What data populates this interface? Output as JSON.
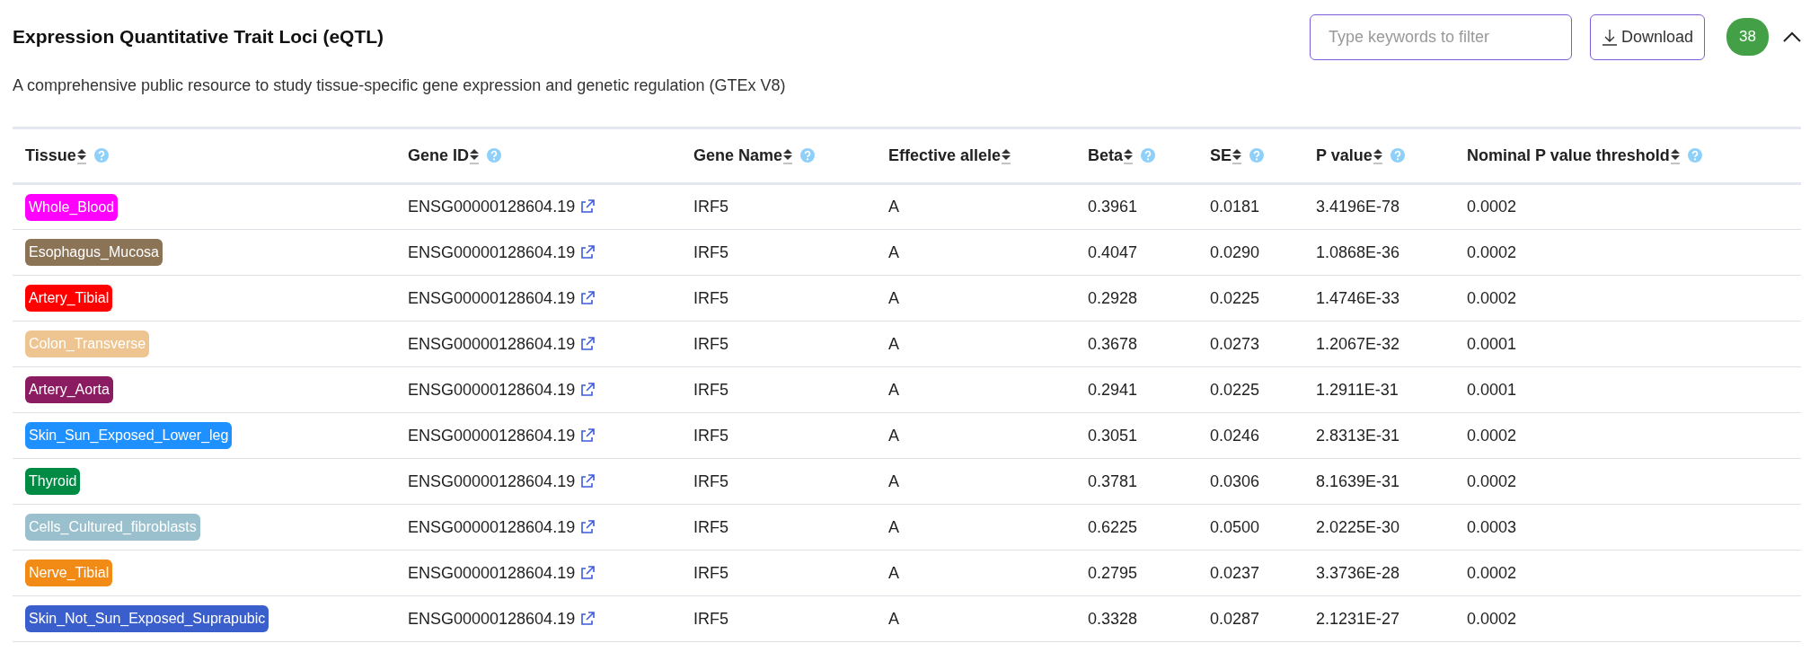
{
  "title": "Expression Quantitative Trait Loci (eQTL)",
  "filter": {
    "placeholder": "Type keywords to filter"
  },
  "download_button": "Download",
  "count_badge": "38",
  "collapse": {
    "expanded": true
  },
  "description": "A comprehensive public resource to study tissue-specific gene expression and genetic regulation (GTEx V8)",
  "table": {
    "columns": [
      {
        "label": "Tissue",
        "help": true
      },
      {
        "label": "Gene ID",
        "help": true
      },
      {
        "label": "Gene Name",
        "help": true
      },
      {
        "label": "Effective allele",
        "help": false
      },
      {
        "label": "Beta",
        "help": true
      },
      {
        "label": "SE",
        "help": true
      },
      {
        "label": "P value",
        "help": true
      },
      {
        "label": "Nominal P value threshold",
        "help": true
      }
    ],
    "rows": [
      {
        "tissue": "Whole_Blood",
        "color": "#ff00ff",
        "gene_id": "ENSG00000128604.19",
        "gene_name": "IRF5",
        "effective_allele": "A",
        "beta": "0.3961",
        "se": "0.0181",
        "p_value": "3.4196E-78",
        "threshold": "0.0002"
      },
      {
        "tissue": "Esophagus_Mucosa",
        "color": "#8b7355",
        "gene_id": "ENSG00000128604.19",
        "gene_name": "IRF5",
        "effective_allele": "A",
        "beta": "0.4047",
        "se": "0.0290",
        "p_value": "1.0868E-36",
        "threshold": "0.0002"
      },
      {
        "tissue": "Artery_Tibial",
        "color": "#ff0000",
        "gene_id": "ENSG00000128604.19",
        "gene_name": "IRF5",
        "effective_allele": "A",
        "beta": "0.2928",
        "se": "0.0225",
        "p_value": "1.4746E-33",
        "threshold": "0.0002"
      },
      {
        "tissue": "Colon_Transverse",
        "color": "#eec591",
        "gene_id": "ENSG00000128604.19",
        "gene_name": "IRF5",
        "effective_allele": "A",
        "beta": "0.3678",
        "se": "0.0273",
        "p_value": "1.2067E-32",
        "threshold": "0.0001"
      },
      {
        "tissue": "Artery_Aorta",
        "color": "#8b1c62",
        "gene_id": "ENSG00000128604.19",
        "gene_name": "IRF5",
        "effective_allele": "A",
        "beta": "0.2941",
        "se": "0.0225",
        "p_value": "1.2911E-31",
        "threshold": "0.0001"
      },
      {
        "tissue": "Skin_Sun_Exposed_Lower_leg",
        "color": "#1e90ff",
        "gene_id": "ENSG00000128604.19",
        "gene_name": "IRF5",
        "effective_allele": "A",
        "beta": "0.3051",
        "se": "0.0246",
        "p_value": "2.8313E-31",
        "threshold": "0.0002"
      },
      {
        "tissue": "Thyroid",
        "color": "#008b45",
        "gene_id": "ENSG00000128604.19",
        "gene_name": "IRF5",
        "effective_allele": "A",
        "beta": "0.3781",
        "se": "0.0306",
        "p_value": "8.1639E-31",
        "threshold": "0.0002"
      },
      {
        "tissue": "Cells_Cultured_fibroblasts",
        "color": "#9ac0cd",
        "gene_id": "ENSG00000128604.19",
        "gene_name": "IRF5",
        "effective_allele": "A",
        "beta": "0.6225",
        "se": "0.0500",
        "p_value": "2.0225E-30",
        "threshold": "0.0003"
      },
      {
        "tissue": "Nerve_Tibial",
        "color": "#f28a16",
        "gene_id": "ENSG00000128604.19",
        "gene_name": "IRF5",
        "effective_allele": "A",
        "beta": "0.2795",
        "se": "0.0237",
        "p_value": "3.3736E-28",
        "threshold": "0.0002"
      },
      {
        "tissue": "Skin_Not_Sun_Exposed_Suprapubic",
        "color": "#3a5fcd",
        "gene_id": "ENSG00000128604.19",
        "gene_name": "IRF5",
        "effective_allele": "A",
        "beta": "0.3328",
        "se": "0.0287",
        "p_value": "2.1231E-27",
        "threshold": "0.0002"
      }
    ]
  }
}
